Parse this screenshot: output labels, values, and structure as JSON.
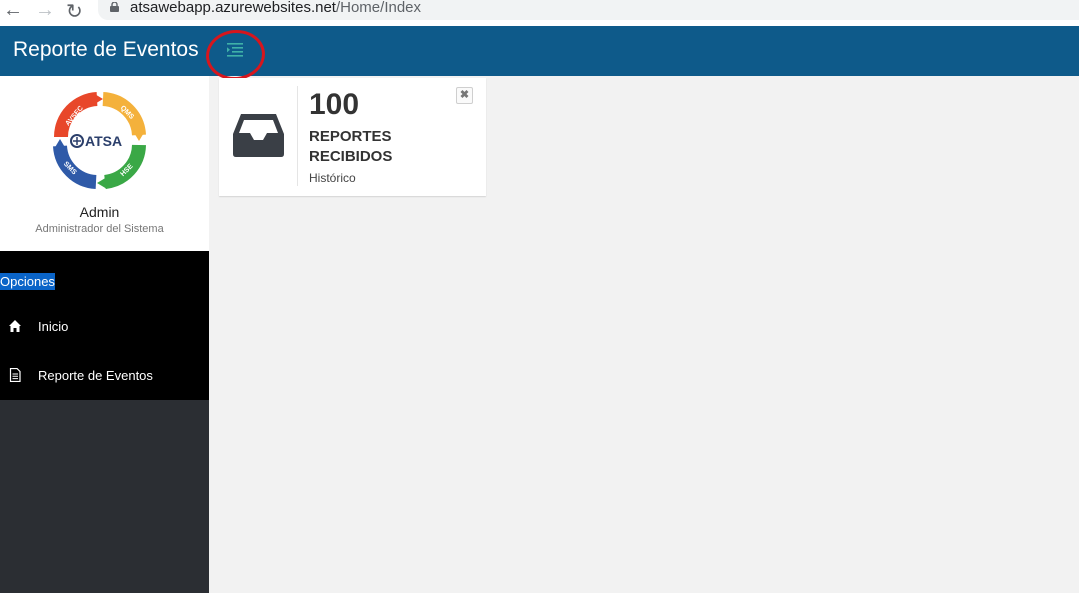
{
  "browser": {
    "url_domain": "atsawebapp.azurewebsites.net",
    "url_path": "/Home/Index"
  },
  "header": {
    "title": "Reporte de Eventos"
  },
  "sidebar": {
    "logo": {
      "center_text": "ATSA",
      "segments": [
        "AVSEC",
        "QMS",
        "HSE",
        "SMS"
      ]
    },
    "profile": {
      "name": "Admin",
      "role": "Administrador del Sistema"
    },
    "menu_header": "Opciones",
    "items": [
      {
        "label": "Inicio",
        "icon": "home-icon"
      },
      {
        "label": "Reporte de Eventos",
        "icon": "document-icon"
      }
    ]
  },
  "info_box": {
    "number": "100",
    "text": "REPORTES RECIBIDOS",
    "subtext": "Histórico",
    "icon": "inbox-icon",
    "close_symbol": "✖"
  },
  "colors": {
    "header_bg": "#0e5a8a",
    "menu_toggle": "#3fb1a8",
    "sidebar_bg": "#2b2e33",
    "highlight": "#0a64c8",
    "annotation_ring": "#d7161d"
  }
}
